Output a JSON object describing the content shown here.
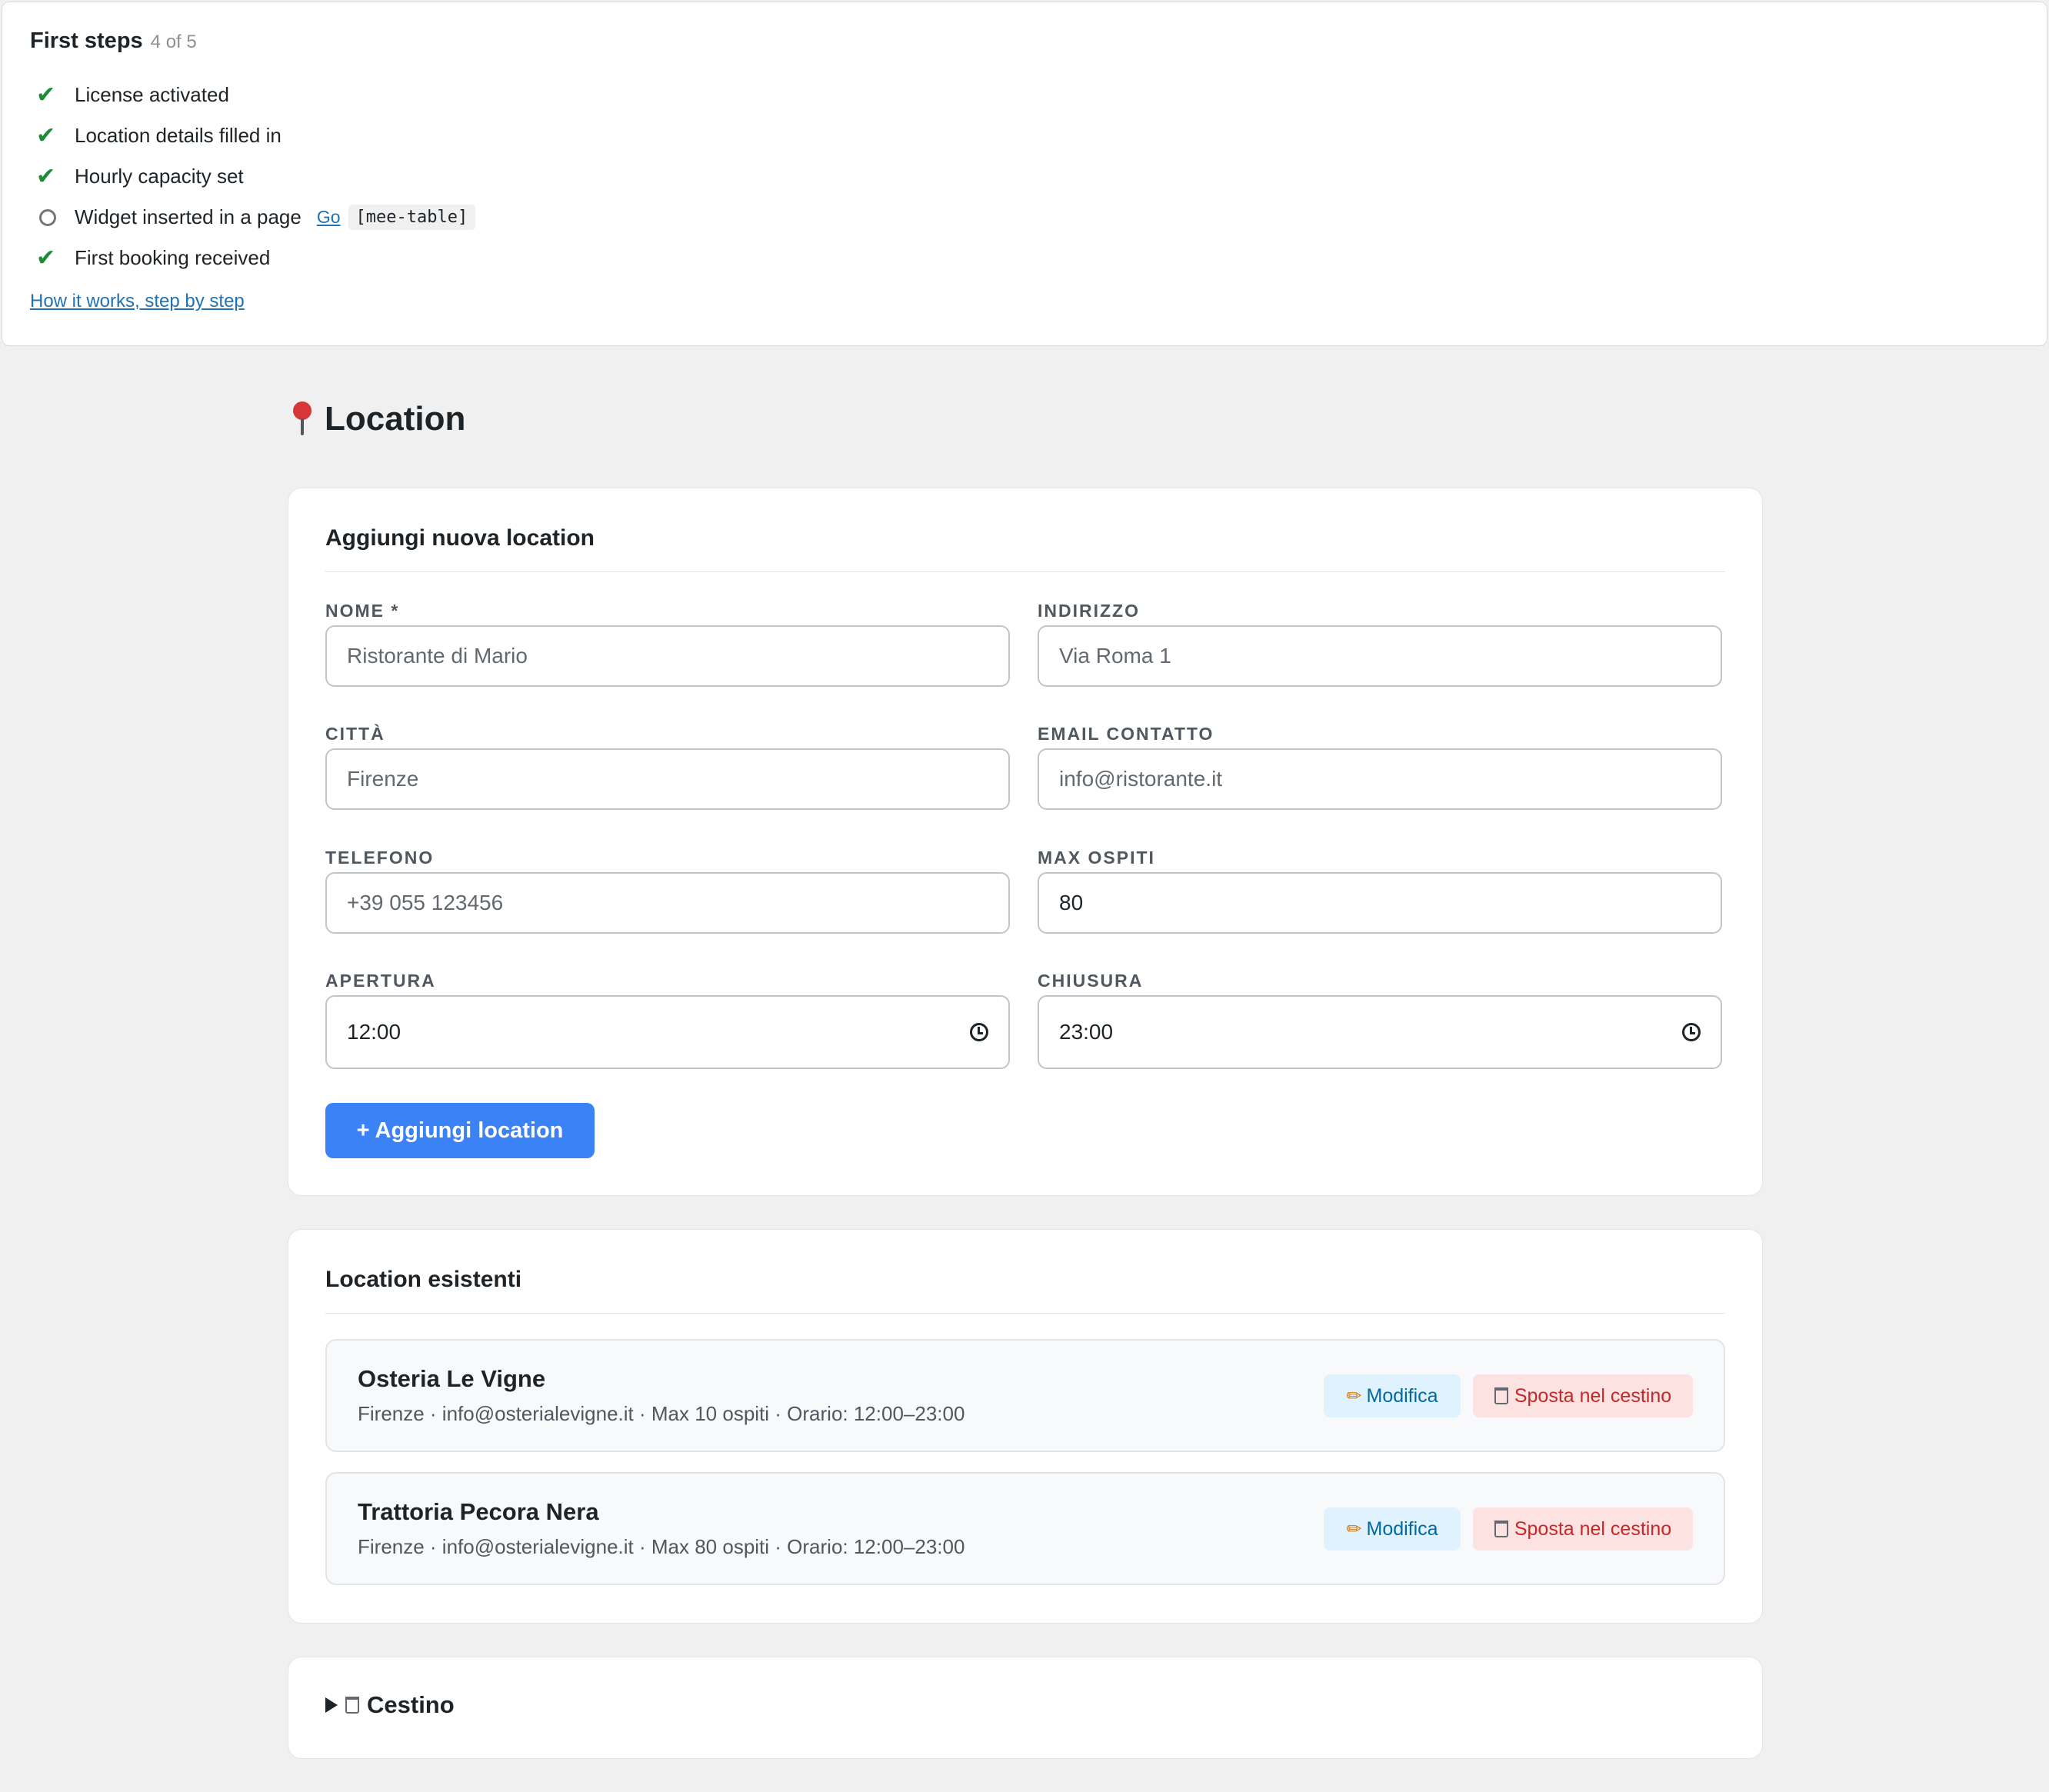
{
  "first_steps": {
    "title": "First steps",
    "progress": "4 of 5",
    "items": [
      {
        "label": "License activated",
        "done": true
      },
      {
        "label": "Location details filled in",
        "done": true
      },
      {
        "label": "Hourly capacity set",
        "done": true
      },
      {
        "label": "Widget inserted in a page",
        "done": false,
        "link": "Go",
        "code": "[mee-table]"
      },
      {
        "label": "First booking received",
        "done": true
      }
    ],
    "help_link": "How it works, step by step"
  },
  "page": {
    "title": "Location",
    "icon": "pin-icon"
  },
  "add_form": {
    "title": "Aggiungi nuova location",
    "fields": {
      "nome": {
        "label": "NOME *",
        "placeholder": "Ristorante di Mario",
        "value": ""
      },
      "indirizzo": {
        "label": "INDIRIZZO",
        "placeholder": "Via Roma 1",
        "value": ""
      },
      "citta": {
        "label": "CITTÀ",
        "placeholder": "Firenze",
        "value": ""
      },
      "email": {
        "label": "EMAIL CONTATTO",
        "placeholder": "info@ristorante.it",
        "value": ""
      },
      "telefono": {
        "label": "TELEFONO",
        "placeholder": "+39 055 123456",
        "value": ""
      },
      "max_ospiti": {
        "label": "MAX OSPITI",
        "value": "80"
      },
      "apertura": {
        "label": "APERTURA",
        "value": "12:00"
      },
      "chiusura": {
        "label": "CHIUSURA",
        "value": "23:00"
      }
    },
    "submit_label": "+ Aggiungi location"
  },
  "existing": {
    "title": "Location esistenti",
    "edit_label": "Modifica",
    "trash_label": "Sposta nel cestino",
    "items": [
      {
        "name": "Osteria Le Vigne",
        "meta": "Firenze · info@osterialevigne.it · Max 10 ospiti · Orario: 12:00–23:00"
      },
      {
        "name": "Trattoria Pecora Nera",
        "meta": "Firenze · info@osterialevigne.it · Max 80 ospiti · Orario: 12:00–23:00"
      }
    ]
  },
  "trash": {
    "label": "Cestino"
  },
  "colors": {
    "primary": "#3b82f6",
    "success": "#1e8a3a",
    "danger": "#c62828",
    "link": "#2271b1"
  }
}
